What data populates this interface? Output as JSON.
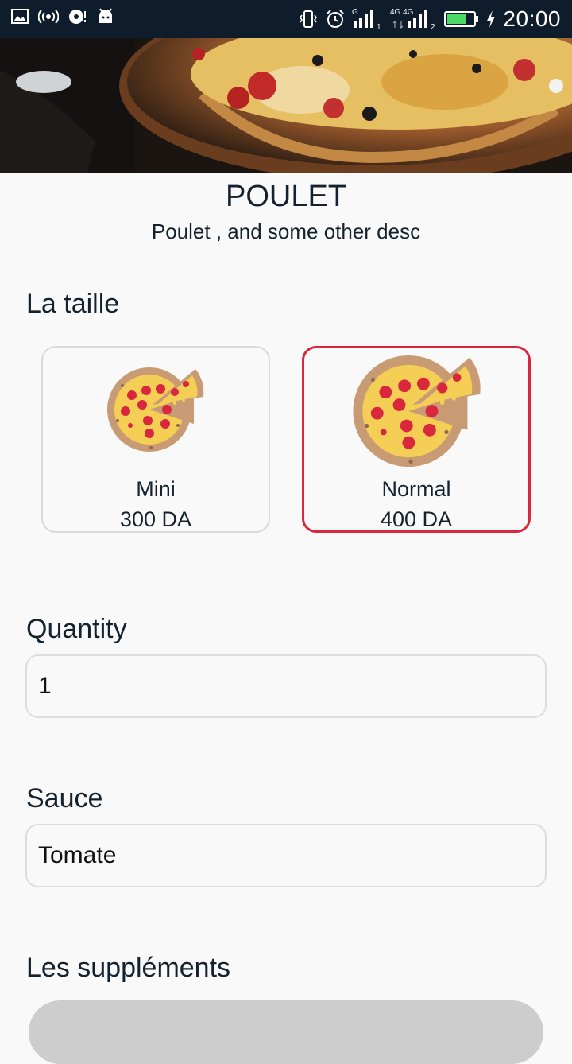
{
  "status_bar": {
    "time": "20:00",
    "icons": [
      "image-icon",
      "hotspot-icon",
      "record-icon",
      "android-icon",
      "vibrate-icon",
      "alarm-icon",
      "signal-g-icon",
      "signal-4g-icon",
      "battery-icon",
      "charging-icon"
    ],
    "network_labels": {
      "sim1": "G",
      "sim1_index": "1",
      "sim2": "4G 4G",
      "sim2_index": "2"
    }
  },
  "product": {
    "title": "POULET",
    "description": "Poulet , and some other desc"
  },
  "size_section": {
    "label": "La taille",
    "options": [
      {
        "name": "Mini",
        "price": "300 DA",
        "selected": false
      },
      {
        "name": "Normal",
        "price": "400 DA",
        "selected": true
      }
    ]
  },
  "quantity": {
    "label": "Quantity",
    "value": "1"
  },
  "sauce": {
    "label": "Sauce",
    "value": "Tomate"
  },
  "supplements": {
    "label": "Les suppléments"
  },
  "colors": {
    "status_bar": "#0f1c2b",
    "background": "#f9f9f9",
    "text": "#14222f",
    "selected_border": "#d9283e",
    "card_border": "#dadada",
    "button_disabled": "#cdcdcd"
  }
}
